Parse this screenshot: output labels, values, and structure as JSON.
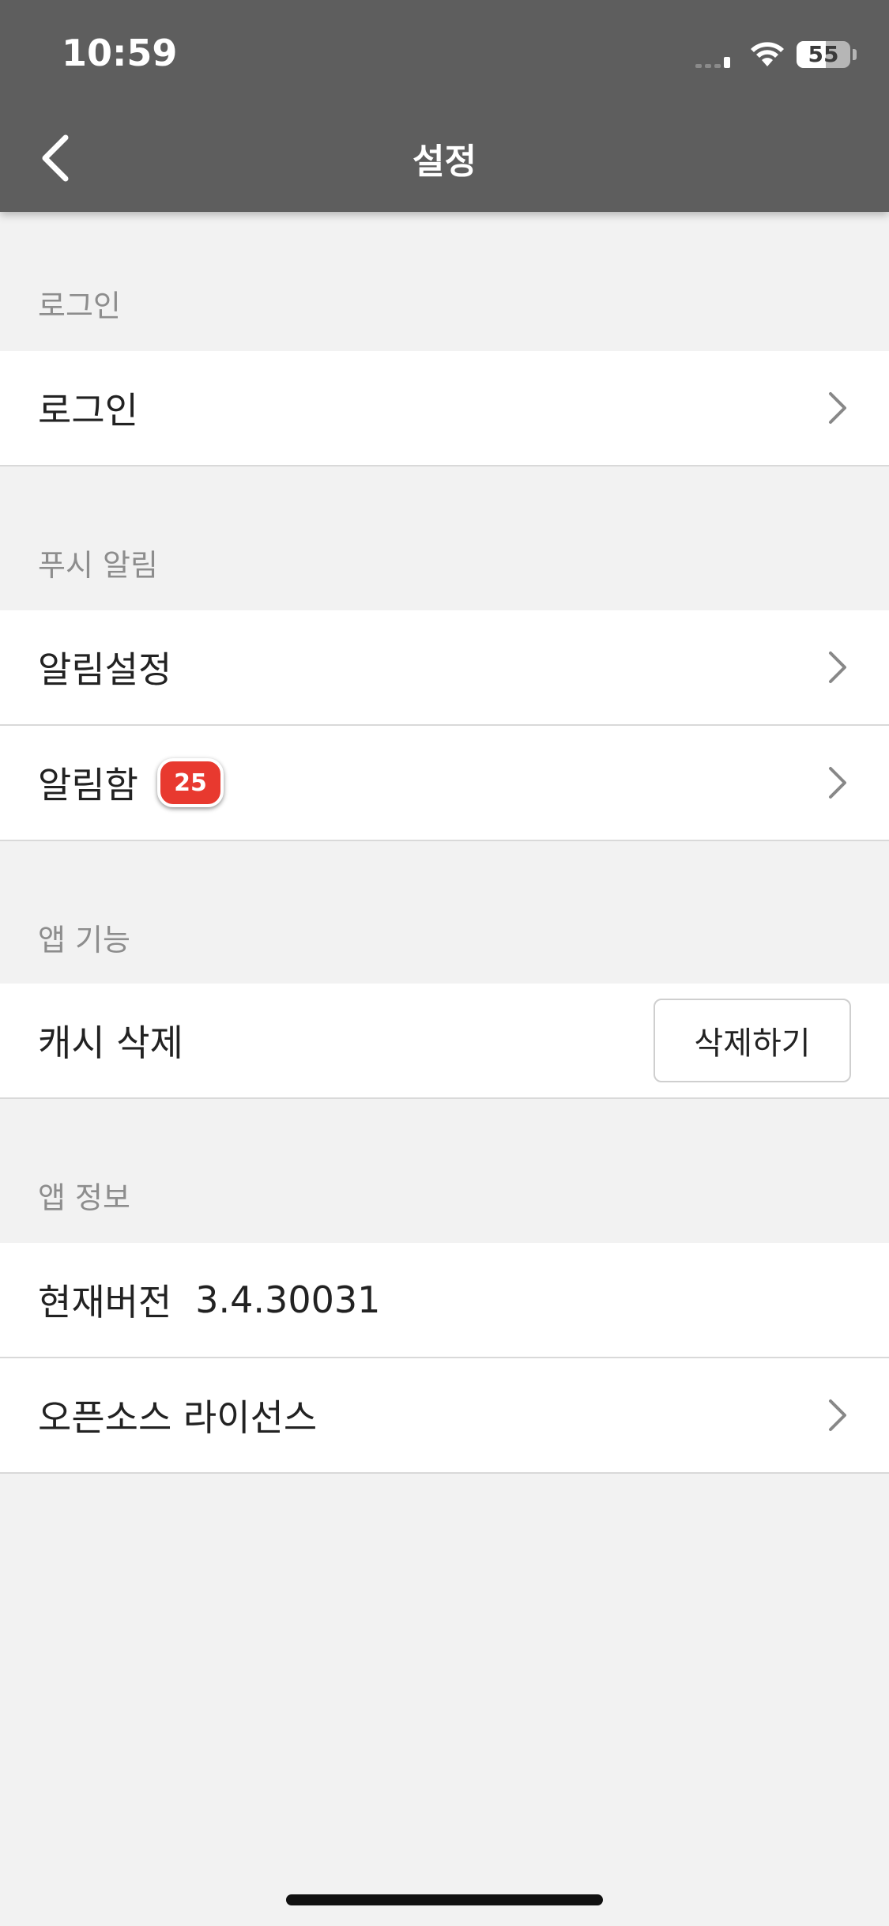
{
  "status_bar": {
    "time": "10:59",
    "battery": "55",
    "battery_level_percent": 55
  },
  "header": {
    "title": "설정",
    "back_icon": "chevron-left-icon"
  },
  "sections": {
    "login": {
      "label": "로그인",
      "items": [
        {
          "label": "로그인",
          "icon": "chevron-right-icon"
        }
      ]
    },
    "push": {
      "label": "푸시 알림",
      "items": [
        {
          "label": "알림설정",
          "icon": "chevron-right-icon"
        },
        {
          "label": "알림함",
          "badge": "25",
          "icon": "chevron-right-icon"
        }
      ]
    },
    "app_features": {
      "label": "앱 기능",
      "items": [
        {
          "label": "캐시 삭제",
          "button": "삭제하기"
        }
      ]
    },
    "app_info": {
      "label": "앱 정보",
      "items": [
        {
          "label": "현재버전",
          "value": "3.4.30031"
        },
        {
          "label": "오픈소스 라이선스",
          "icon": "chevron-right-icon"
        }
      ]
    }
  },
  "colors": {
    "header_bg": "#5e5e5e",
    "page_bg": "#f2f2f2",
    "badge": "#e8392f",
    "section_label": "#8d8d8d"
  }
}
